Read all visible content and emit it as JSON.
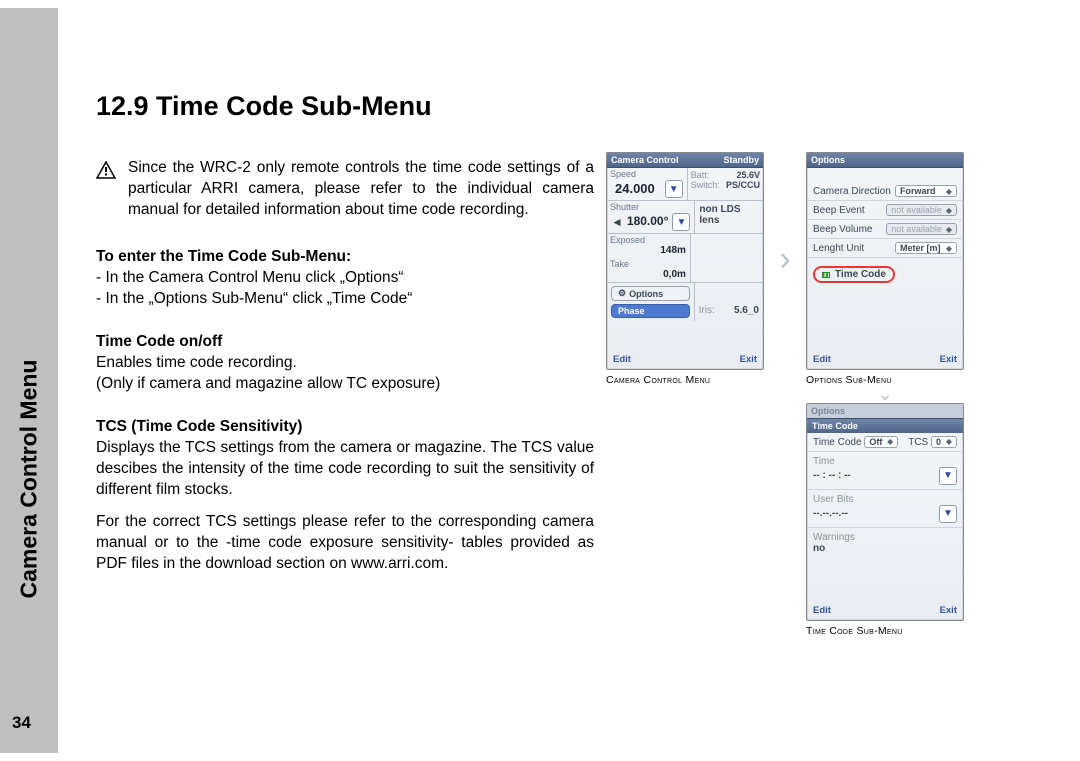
{
  "sidebar": {
    "title": "Camera Control Menu",
    "page_number": "34"
  },
  "heading": "12.9 Time Code Sub-Menu",
  "intro": "Since the WRC-2 only remote controls the time code settings of a particular ARRI camera, please refer to the individual camera manual for detailed information about time code recording.",
  "sec1_title": "To enter the Time Code Sub-Menu:",
  "sec1_b1": "- In the Camera Control Menu click „Options“",
  "sec1_b2": "- In the „Options Sub-Menu“ click „Time Code“",
  "sec2_title": "Time Code on/off",
  "sec2_l1": "Enables time code recording.",
  "sec2_l2": "(Only if camera and magazine allow TC exposure)",
  "sec3_title": "TCS (Time Code Sensitivity)",
  "sec3_p1": "Displays the TCS settings from the camera or magazine. The TCS value descibes the intensity of the time code recording to suit the sensitivity of different film stocks.",
  "sec3_p2": "For the correct TCS settings please refer to the corresponding camera manual or to the -time code exposure sensitivity- tables provided as PDF files in the download section on www.arri.com.",
  "captions": {
    "a": "Camera Control Menu",
    "b": "Options Sub-Menu",
    "c": "Time Code Sub-Menu"
  },
  "btns": {
    "edit": "Edit",
    "exit": "Exit",
    "options": "Options",
    "phase": "Phase",
    "timecode": "Time Code"
  },
  "scrA": {
    "title": "Camera Control",
    "status": "Standby",
    "speed_lbl": "Speed",
    "speed": "24.000",
    "batt_lbl": "Batt:",
    "batt": "25.6V",
    "switch_lbl": "Switch:",
    "sw": "PS/CCU",
    "shutter_lbl": "Shutter",
    "shutter": "180.00°",
    "lens": "non LDS lens",
    "exposed_lbl": "Exposed",
    "exposed": "148m",
    "take_lbl": "Take",
    "take": "0,0m",
    "iris_lbl": "Iris:",
    "iris": "5.6_0"
  },
  "scrB": {
    "title": "Options",
    "camdir_lbl": "Camera Direction",
    "camdir": "Forward",
    "beepev_lbl": "Beep Event",
    "beepev": "not available",
    "beepvol_lbl": "Beep Volume",
    "beepvol": "not available",
    "len_lbl": "Lenght Unit",
    "len": "Meter [m]"
  },
  "scrC": {
    "title": "Options",
    "bar": "Time Code",
    "tc_lbl": "Time Code",
    "tc": "Off",
    "tcs_lbl": "TCS",
    "tcs": "0",
    "time_lbl": "Time",
    "time": "-- : -- : --",
    "ub_lbl": "User Bits",
    "ub": "--.--.--.--",
    "warn_lbl": "Warnings",
    "warn": "no"
  }
}
